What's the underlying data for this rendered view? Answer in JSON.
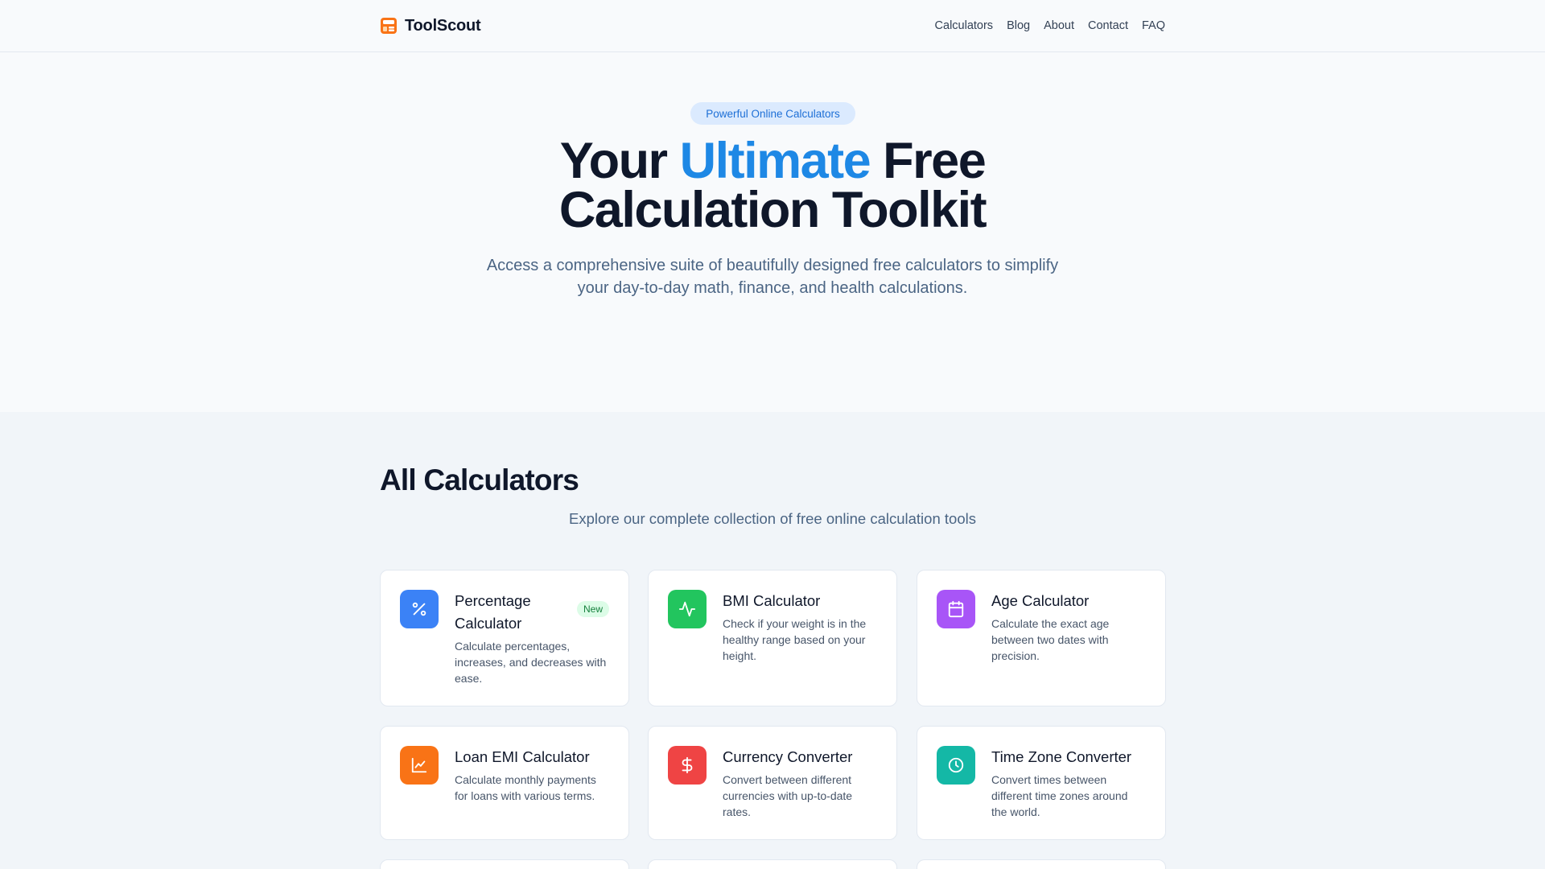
{
  "brand": {
    "name": "ToolScout",
    "logo_icon": "calculator-logo-icon",
    "logo_color": "#f97316"
  },
  "nav": {
    "items": [
      {
        "label": "Calculators"
      },
      {
        "label": "Blog"
      },
      {
        "label": "About"
      },
      {
        "label": "Contact"
      },
      {
        "label": "FAQ"
      }
    ]
  },
  "hero": {
    "pill": "Powerful Online Calculators",
    "title_part1": "Your ",
    "title_accent": "Ultimate",
    "title_part2": " Free",
    "title_line2": "Calculation Toolkit",
    "subtitle": "Access a comprehensive suite of beautifully designed free calculators to simplify your day-to-day math, finance, and health calculations.",
    "accent_color": "#1e88e5"
  },
  "calculators": {
    "title": "All Calculators",
    "subtitle": "Explore our complete collection of free online calculation tools",
    "cards": [
      {
        "title": "Percentage Calculator",
        "desc": "Calculate percentages, increases, and decreases with ease.",
        "icon": "percent-icon",
        "color": "#3b82f6",
        "badge": "New"
      },
      {
        "title": "BMI Calculator",
        "desc": "Check if your weight is in the healthy range based on your height.",
        "icon": "activity-icon",
        "color": "#22c55e"
      },
      {
        "title": "Age Calculator",
        "desc": "Calculate the exact age between two dates with precision.",
        "icon": "calendar-icon",
        "color": "#a855f7"
      },
      {
        "title": "Loan EMI Calculator",
        "desc": "Calculate monthly payments for loans with various terms.",
        "icon": "line-chart-icon",
        "color": "#f97316"
      },
      {
        "title": "Currency Converter",
        "desc": "Convert between different currencies with up-to-date rates.",
        "icon": "dollar-icon",
        "color": "#ef4444"
      },
      {
        "title": "Time Zone Converter",
        "desc": "Convert times between different time zones around the world.",
        "icon": "clock-icon",
        "color": "#14b8a6"
      }
    ]
  }
}
